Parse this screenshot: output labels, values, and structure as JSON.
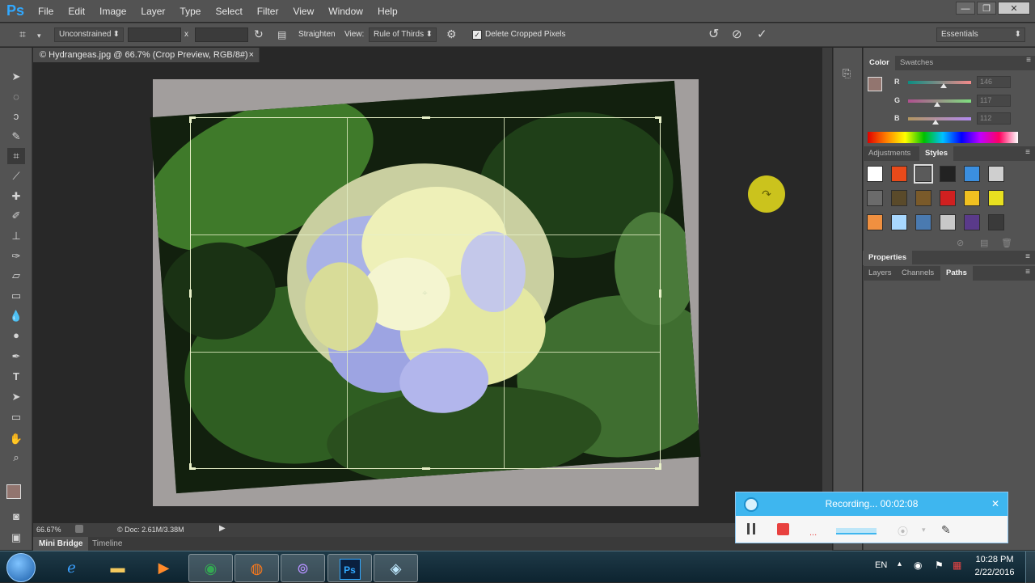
{
  "app": {
    "logo": "Ps",
    "menu": [
      "File",
      "Edit",
      "Image",
      "Layer",
      "Type",
      "Select",
      "Filter",
      "View",
      "Window",
      "Help"
    ],
    "window_controls": {
      "minimize": "—",
      "restore": "❐",
      "close": "✕"
    }
  },
  "options_bar": {
    "ratio_select": "Unconstrained",
    "x_sep": "x",
    "straighten": "Straighten",
    "view_label": "View:",
    "view_select": "Rule of Thirds",
    "delete_cropped": "Delete Cropped Pixels",
    "workspace": "Essentials"
  },
  "document": {
    "tab_title": "© Hydrangeas.jpg @ 66.7% (Crop Preview, RGB/8#)",
    "tab_close": "×",
    "zoom": "66.67%",
    "doc_size": "© Doc: 2.61M/3.38M"
  },
  "bottom_tabs": [
    "Mini Bridge",
    "Timeline"
  ],
  "panels": {
    "color_tabs": [
      "Color",
      "Swatches"
    ],
    "rgb": [
      {
        "label": "R",
        "value": "146",
        "fraction": 0.57
      },
      {
        "label": "G",
        "value": "117",
        "fraction": 0.46
      },
      {
        "label": "B",
        "value": "112",
        "fraction": 0.44
      }
    ],
    "foreground_color": "#92756f",
    "style_tabs": [
      "Adjustments",
      "Styles"
    ],
    "props_tabs": [
      "Properties"
    ],
    "layer_tabs": [
      "Layers",
      "Channels",
      "Paths"
    ]
  },
  "recorder": {
    "status": "Recording... 00:02:08",
    "close": "✕"
  },
  "taskbar": {
    "lang": "EN",
    "time": "10:28 PM",
    "date": "2/22/2016"
  },
  "colors": {
    "accent_blue": "#31a8ff",
    "record_red": "#e8413f",
    "rec_header": "#3eb6ef"
  }
}
